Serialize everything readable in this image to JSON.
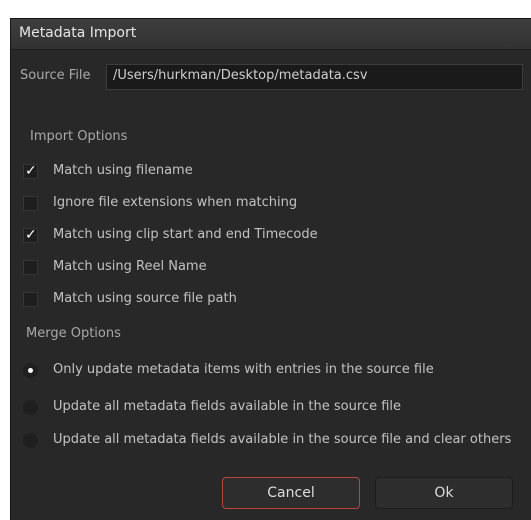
{
  "dialog": {
    "title": "Metadata Import"
  },
  "source": {
    "label": "Source File",
    "value": "/Users/hurkman/Desktop/metadata.csv"
  },
  "import_options": {
    "title": "Import Options",
    "items": [
      {
        "label": "Match using filename",
        "checked": true
      },
      {
        "label": "Ignore file extensions when matching",
        "checked": false
      },
      {
        "label": "Match using clip start and end Timecode",
        "checked": true
      },
      {
        "label": "Match using Reel Name",
        "checked": false
      },
      {
        "label": "Match using source file path",
        "checked": false
      }
    ]
  },
  "merge_options": {
    "title": "Merge Options",
    "items": [
      {
        "label": "Only update metadata items with entries in the source file",
        "selected": true
      },
      {
        "label": "Update all metadata fields available in the source file",
        "selected": false
      },
      {
        "label": "Update all metadata fields available in the source file and clear others",
        "selected": false
      }
    ]
  },
  "buttons": {
    "cancel_label": "Cancel",
    "ok_label": "Ok"
  },
  "colors": {
    "dialog_bg": "#282828",
    "accent_cancel_border": "#b9443e"
  },
  "glyphs": {
    "check": "✓"
  }
}
